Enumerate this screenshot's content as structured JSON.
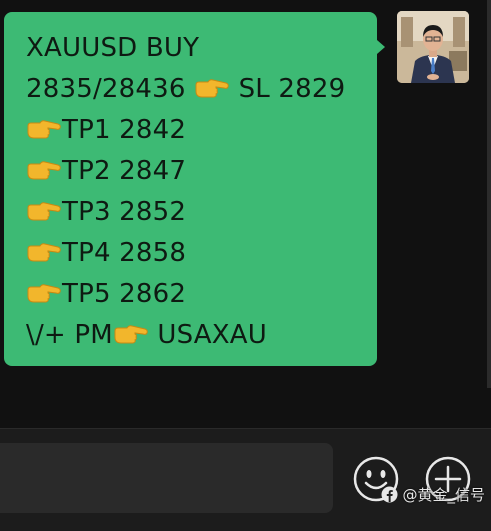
{
  "message": {
    "lines": [
      {
        "pre": "XAUUSD BUY",
        "hand": false,
        "post": ""
      },
      {
        "pre": "2835/28436 ",
        "hand": true,
        "post": " SL 2829"
      },
      {
        "pre": "",
        "hand": true,
        "post": "TP1 2842"
      },
      {
        "pre": "",
        "hand": true,
        "post": "TP2 2847"
      },
      {
        "pre": "",
        "hand": true,
        "post": "TP3 2852"
      },
      {
        "pre": "",
        "hand": true,
        "post": "TP4 2858"
      },
      {
        "pre": "",
        "hand": true,
        "post": "TP5 2862"
      },
      {
        "pre": "\\/+ PM",
        "hand": true,
        "post": " USAXAU"
      }
    ],
    "bubble_color": "#3dba74",
    "hand_icon": "backhand-index-pointing-right-icon"
  },
  "input_bar": {
    "emoji_icon": "smiley-face-icon",
    "plus_icon": "plus-circle-icon"
  },
  "watermark": {
    "text": "@黄金_信号",
    "logo_icon": "facebook-logo-icon"
  }
}
